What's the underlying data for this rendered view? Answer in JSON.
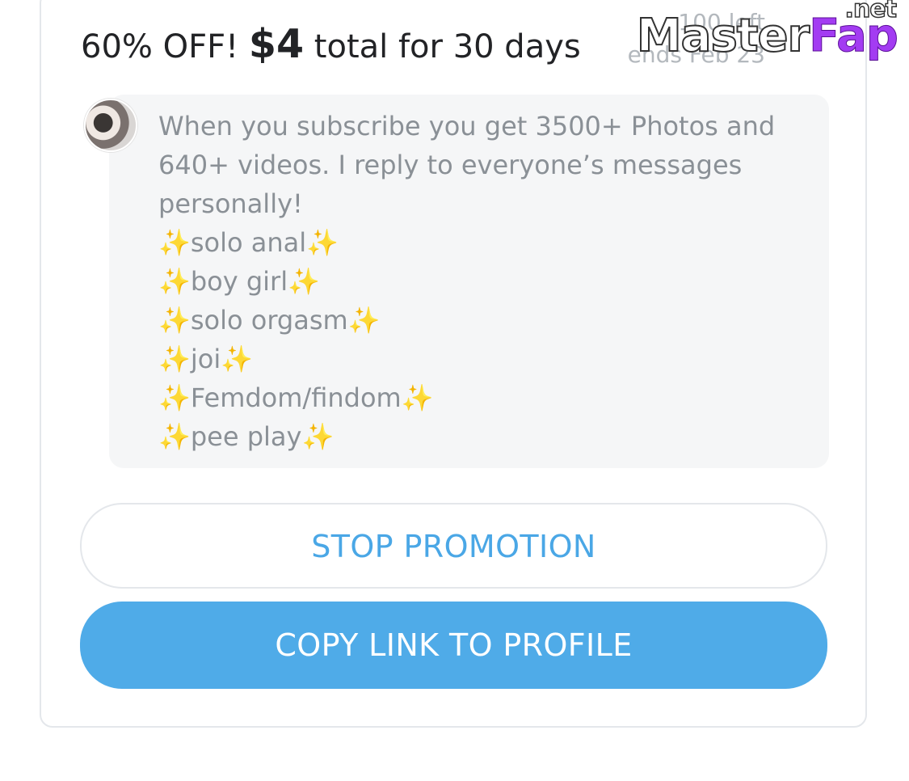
{
  "offer": {
    "lead": "60% OFF!",
    "price": "$4",
    "rest": "total for 30 days",
    "left": "100 left",
    "ends": "ends Feb 23"
  },
  "message": {
    "lines": [
      "When you subscribe you get 3500+ Photos and",
      "640+ videos. I reply to everyone’s messages",
      "personally!"
    ],
    "items": [
      "solo anal",
      "boy girl",
      "solo orgasm",
      "joi",
      "Femdom/findom",
      "pee play"
    ],
    "sparkle": "✨"
  },
  "buttons": {
    "stop": "STOP PROMOTION",
    "copy": "COPY LINK TO PROFILE"
  },
  "watermark": {
    "part1": "Master",
    "part2": "Fap",
    "part3": ".net"
  },
  "colors": {
    "accent": "#4fabe8",
    "accent_text": "#4aa7e6",
    "bubble": "#f5f6f7",
    "sparkle": "#f0c52d"
  },
  "avatar": {
    "icon": "user-avatar-icon"
  }
}
